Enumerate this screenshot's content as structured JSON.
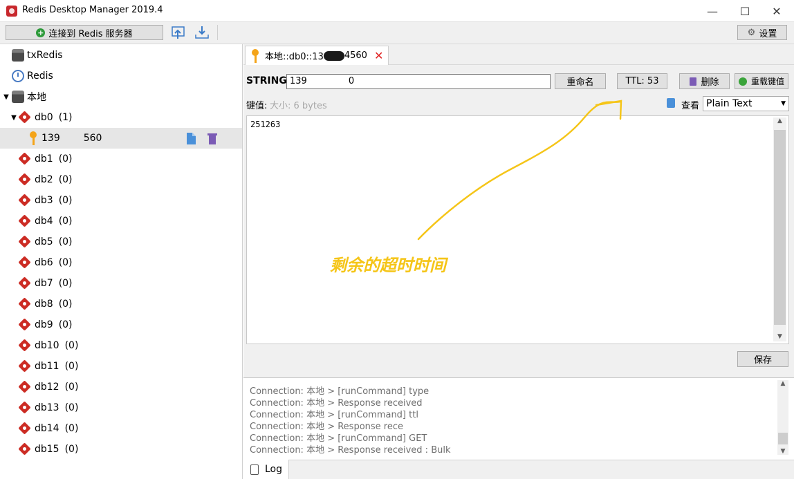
{
  "window": {
    "title": "Redis Desktop Manager 2019.4",
    "minimize": "—",
    "maximize": "☐",
    "close": "✕"
  },
  "toolbar": {
    "connect_label": "连接到 Redis 服务器",
    "settings_label": "设置"
  },
  "sidebar": {
    "connections": [
      {
        "label": "txRedis",
        "icon": "server-icon"
      },
      {
        "label": "Redis",
        "icon": "clock-icon"
      },
      {
        "label": "本地",
        "icon": "server-icon",
        "expanded": true
      }
    ],
    "selected_db": {
      "label": "db0",
      "count": "(1)",
      "expanded": true
    },
    "selected_key": {
      "label": "139",
      "suffix": "560"
    },
    "dbs": [
      {
        "label": "db1",
        "count": "(0)"
      },
      {
        "label": "db2",
        "count": "(0)"
      },
      {
        "label": "db3",
        "count": "(0)"
      },
      {
        "label": "db4",
        "count": "(0)"
      },
      {
        "label": "db5",
        "count": "(0)"
      },
      {
        "label": "db6",
        "count": "(0)"
      },
      {
        "label": "db7",
        "count": "(0)"
      },
      {
        "label": "db8",
        "count": "(0)"
      },
      {
        "label": "db9",
        "count": "(0)"
      },
      {
        "label": "db10",
        "count": "(0)"
      },
      {
        "label": "db11",
        "count": "(0)"
      },
      {
        "label": "db12",
        "count": "(0)"
      },
      {
        "label": "db13",
        "count": "(0)"
      },
      {
        "label": "db14",
        "count": "(0)"
      },
      {
        "label": "db15",
        "count": "(0)"
      }
    ]
  },
  "key_tab": {
    "title_prefix": "本地::db0::13",
    "title_suffix": "4560",
    "close": "✕"
  },
  "key_view": {
    "type_label": "STRING:",
    "key_name": "139",
    "key_name_suffix": "0",
    "rename_label": "重命名",
    "ttl_label": "TTL:  53",
    "delete_label": "删除",
    "reload_label": "重载键值",
    "value_label": "键值:",
    "size_label": "大小:  6 bytes",
    "view_label": "查看",
    "format": "Plain Text",
    "value": "251263",
    "save_label": "保存"
  },
  "log": {
    "lines": [
      "Connection: 本地 > [runCommand] type",
      "Connection: 本地 > Response received",
      "Connection: 本地 > [runCommand] ttl",
      "Connection: 本地 > Response rece",
      "Connection: 本地 > [runCommand] GET",
      "Connection: 本地 > Response received : Bulk"
    ],
    "tab_label": "Log"
  },
  "annotation": {
    "text": "剩余的超时时间",
    "color": "#f5c518"
  },
  "colors": {
    "redis_red": "#cc2c24",
    "key_orange": "#f4a419",
    "selection": "#e6e6e6"
  }
}
